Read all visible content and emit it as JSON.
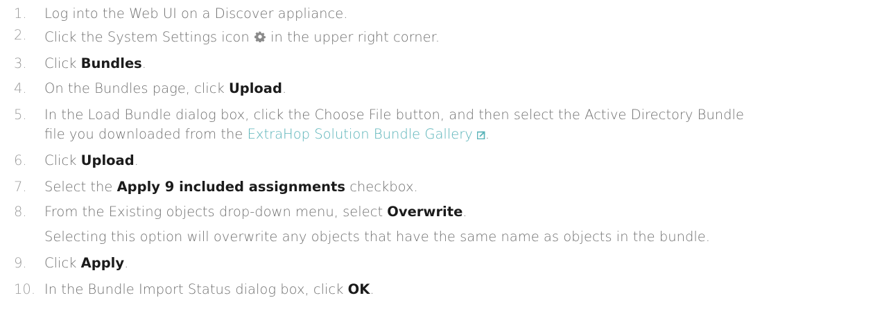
{
  "steps": [
    {
      "number": "1.",
      "text": "Log into the Web UI on a Discover appliance."
    },
    {
      "number": "2.",
      "before_icon": "Click the System Settings icon",
      "icon": "gear-icon",
      "after_icon": "in the upper right corner."
    },
    {
      "number": "3.",
      "before": "Click ",
      "bold": "Bundles",
      "after": "."
    },
    {
      "number": "4.",
      "before": "On the Bundles page, click ",
      "bold": "Upload",
      "after": "."
    },
    {
      "number": "5.",
      "line1": "In the Load Bundle dialog box, click the Choose File button, and then select the Active Directory Bundle",
      "line2_before": "file you downloaded from the ",
      "link": "ExtraHop Solution Bundle Gallery",
      "link_icon": "external-link-icon",
      "line2_after": "."
    },
    {
      "number": "6.",
      "before": "Click ",
      "bold": "Upload",
      "after": "."
    },
    {
      "number": "7.",
      "before": "Select the ",
      "bold": "Apply 9 included assignments",
      "after": " checkbox."
    },
    {
      "number": "8.",
      "before": "From the Existing objects drop-down menu, select ",
      "bold": "Overwrite",
      "after": ".",
      "note": "Selecting this option will overwrite any objects that have the same name as objects in the bundle."
    },
    {
      "number": "9.",
      "before": "Click ",
      "bold": "Apply",
      "after": "."
    },
    {
      "number": "10.",
      "before": "In the Bundle Import Status dialog box, click ",
      "bold": "OK",
      "after": "."
    }
  ],
  "colors": {
    "text": "#6f6f6f",
    "number": "#9a9a9a",
    "bold": "#1b1b1b",
    "link": "#59b3b8"
  }
}
